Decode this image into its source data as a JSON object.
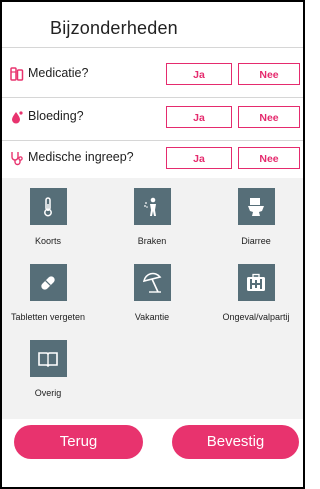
{
  "header": {
    "title": "Bijzonderheden"
  },
  "questions": [
    {
      "label": "Medicatie?",
      "icon": "pill-bottle-icon",
      "yes": "Ja",
      "no": "Nee"
    },
    {
      "label": "Bloeding?",
      "icon": "blood-drop-icon",
      "yes": "Ja",
      "no": "Nee"
    },
    {
      "label": "Medische ingreep?",
      "icon": "stethoscope-icon",
      "yes": "Ja",
      "no": "Nee"
    }
  ],
  "categories": [
    {
      "label": "Koorts",
      "icon": "thermometer-icon"
    },
    {
      "label": "Braken",
      "icon": "vomiting-person-icon"
    },
    {
      "label": "Diarree",
      "icon": "toilet-icon"
    },
    {
      "label": "Tabletten vergeten",
      "icon": "capsule-icon"
    },
    {
      "label": "Vakantie",
      "icon": "beach-umbrella-icon"
    },
    {
      "label": "Ongeval/valpartij",
      "icon": "first-aid-kit-icon"
    },
    {
      "label": "Overig",
      "icon": "open-book-icon"
    }
  ],
  "actions": {
    "back": "Terug",
    "confirm": "Bevestig"
  },
  "colors": {
    "accent": "#e8336e",
    "tile": "#566e78",
    "grid_bg": "#f2f2f2"
  }
}
